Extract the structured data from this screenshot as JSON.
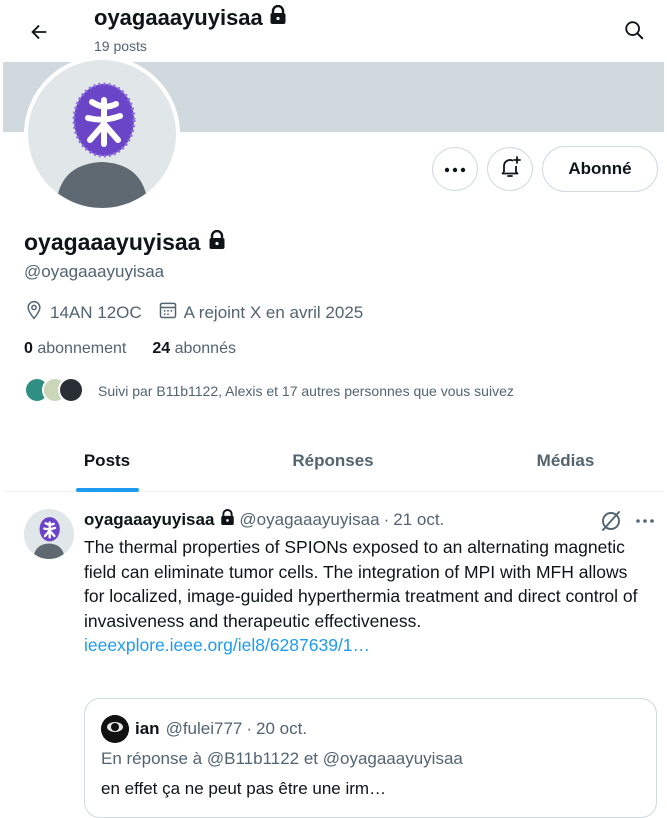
{
  "header": {
    "display_name": "oyagaaayuyisaa",
    "posts_count": "19 posts"
  },
  "profile": {
    "display_name": "oyagaaayuyisaa",
    "handle": "@oyagaaayuyisaa",
    "location": "14AN 12OC",
    "joined": "A rejoint X en avril 2025",
    "following_count": "0",
    "following_label": "abonnement",
    "followers_count": "24",
    "followers_label": "abonnés",
    "followed_by": "Suivi par B11b1122, Alexis et 17 autres personnes que vous suivez"
  },
  "actions": {
    "follow_label": "Abonné"
  },
  "tabs": [
    {
      "label": "Posts"
    },
    {
      "label": "Réponses"
    },
    {
      "label": "Médias"
    }
  ],
  "post": {
    "display_name": "oyagaaayuyisaa",
    "handle": "@oyagaaayuyisaa",
    "sep": "·",
    "date": "21 oct.",
    "text": "The thermal properties of SPIONs exposed to an alternating magnetic field can eliminate tumor cells. The integration of MPI with MFH allows for localized, image-guided hyperthermia treatment and direct control of invasiveness and therapeutic effectiveness.",
    "link": "ieeexplore.ieee.org/iel8/6287639/1…",
    "quote": {
      "display_name": "ian",
      "handle": "@fulei777",
      "sep": "·",
      "date": "20 oct.",
      "reply_to": "En réponse à @B11b1122  et  @oyagaaayuyisaa",
      "text": "en effet ça ne peut pas être une irm…"
    }
  },
  "colors": {
    "accent": "#1d9bf0",
    "banner": "#cfd9de",
    "secondary_text": "#536471"
  }
}
